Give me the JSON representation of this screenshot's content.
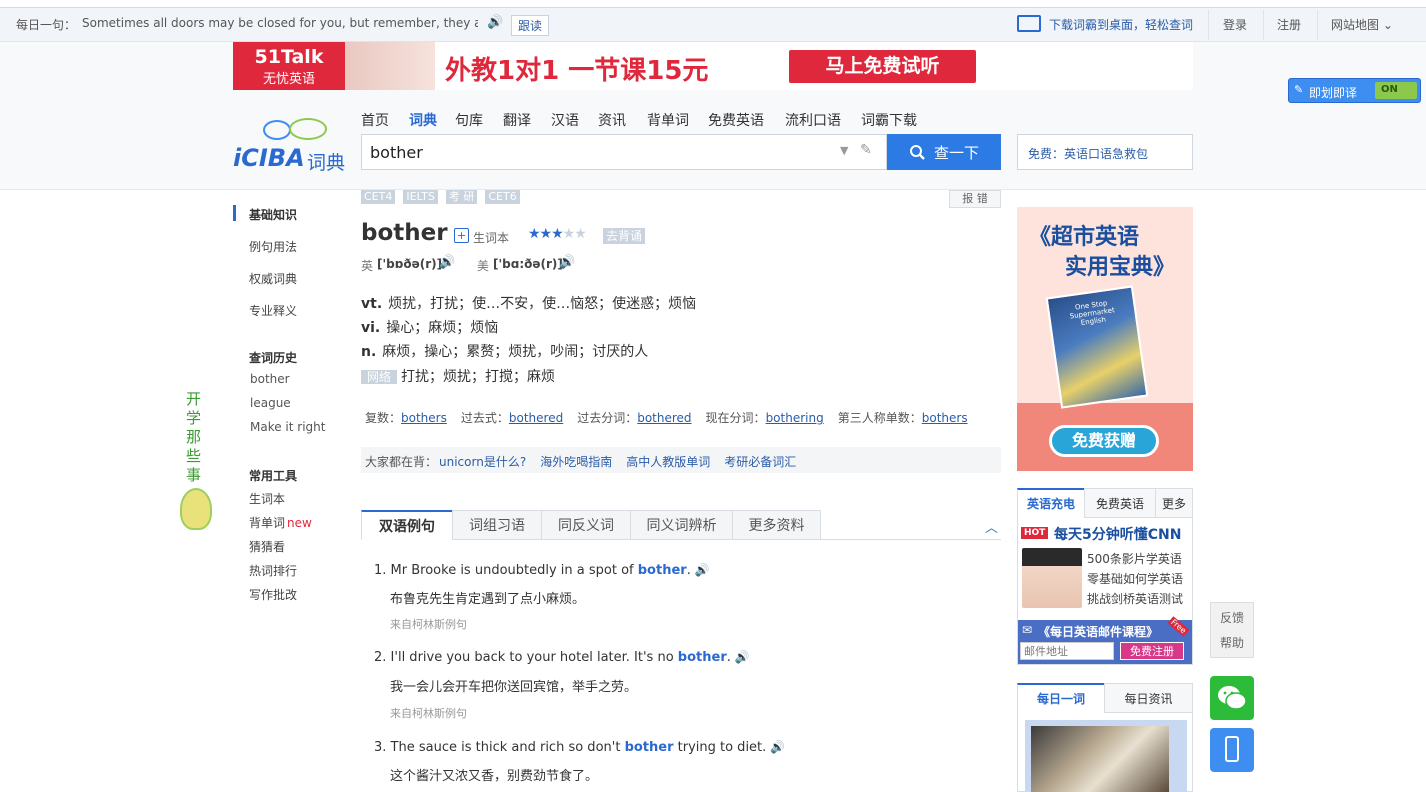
{
  "topbar": {
    "daily_label": "每日一句：",
    "daily_sentence": "Sometimes all doors may be closed for you, but remember, they aren't l...",
    "follow_read": "跟读",
    "download_link": "下载词霸到桌面，轻松查词",
    "login": "登录",
    "register": "注册",
    "sitemap": "网站地图"
  },
  "banner": {
    "brand": "51Talk",
    "brand_sub": "无忧英语",
    "headline": "外教1对1 一节课15元",
    "cta": "马上免费试听"
  },
  "toggle": {
    "label": "即划即译",
    "state": "ON"
  },
  "logo": {
    "text": "iCIBA",
    "suffix": "词典"
  },
  "nav": [
    "首页",
    "词典",
    "句库",
    "翻译",
    "汉语",
    "资讯",
    "背单词",
    "免费英语",
    "流利口语",
    "词霸下载"
  ],
  "search": {
    "value": "bother",
    "button": "查一下",
    "promo": "免费：英语口语急救包"
  },
  "tags": [
    "CET4",
    "IELTS",
    "考 研",
    "CET6"
  ],
  "report": "报 错",
  "sidebar": {
    "basic": "基础知识",
    "items": [
      "例句用法",
      "权威词典",
      "专业释义"
    ],
    "history_head": "查词历史",
    "history": [
      "bother",
      "league",
      "Make it right"
    ],
    "tools_head": "常用工具",
    "tools": [
      "生词本",
      "背单词",
      "猜猜看",
      "热词排行",
      "写作批改"
    ],
    "new_badge": "new"
  },
  "left_deco": "开学那些事",
  "word": {
    "headword": "bother",
    "add_vocab": "生词本",
    "stars": 3,
    "recite": "去背诵",
    "uk_label": "英",
    "uk_pron": "['bɒðə(r)]",
    "us_label": "美",
    "us_pron": "['bɑ:ðə(r)]"
  },
  "definitions": [
    {
      "pos": "vt.",
      "text": "烦扰，打扰；使…不安，使…恼怒；使迷惑；烦恼"
    },
    {
      "pos": "vi.",
      "text": "操心；麻烦；烦恼"
    },
    {
      "pos": "n.",
      "text": "麻烦，操心；累赘；烦扰，吵闹；讨厌的人"
    },
    {
      "pos": "网络",
      "text": "打扰；烦扰；打搅；麻烦"
    }
  ],
  "forms": [
    {
      "label": "复数：",
      "value": "bothers"
    },
    {
      "label": "过去式：",
      "value": "bothered"
    },
    {
      "label": "过去分词：",
      "value": "bothered"
    },
    {
      "label": "现在分词：",
      "value": "bothering"
    },
    {
      "label": "第三人称单数：",
      "value": "bothers"
    }
  ],
  "everyone": {
    "label": "大家都在背：",
    "links": [
      "unicorn是什么?",
      "海外吃喝指南",
      "高中人教版单词",
      "考研必备词汇"
    ]
  },
  "tabs": [
    "双语例句",
    "词组习语",
    "同反义词",
    "同义词辨析",
    "更多资料"
  ],
  "examples": [
    {
      "num": "1.",
      "pre": "Mr Brooke is undoubtedly in a spot of ",
      "kw": "bother",
      "post": ".",
      "zh": "布鲁克先生肯定遇到了点小麻烦。",
      "src": "来自柯林斯例句"
    },
    {
      "num": "2.",
      "pre": "I'll drive you back to your hotel later. It's no ",
      "kw": "bother",
      "post": ".",
      "zh": "我一会儿会开车把你送回宾馆，举手之劳。",
      "src": "来自柯林斯例句"
    },
    {
      "num": "3.",
      "pre": "The sauce is thick and rich so don't ",
      "kw": "bother",
      "post": " trying to diet.",
      "zh": "这个酱汁又浓又香，别费劲节食了。",
      "src": ""
    }
  ],
  "ad_book": {
    "title1": "《超市英语",
    "title1_hl": "英语",
    "title2": "实用宝典》",
    "book_en": "One Stop Supermarket English",
    "cta": "免费获赠"
  },
  "right_tabs": [
    "英语充电",
    "免费英语",
    "更多"
  ],
  "cnn": {
    "hot": "HOT",
    "title": "每天5分钟听懂CNN",
    "lines": [
      "500条影片学英语",
      "零基础如何学英语",
      "挑战剑桥英语测试"
    ]
  },
  "mail": {
    "title": "《每日英语邮件课程》",
    "free": "Free",
    "placeholder": "邮件地址",
    "button": "免费注册"
  },
  "daily_tabs": [
    "每日一词",
    "每日资讯"
  ],
  "float": {
    "feedback": "反馈",
    "help": "帮助"
  },
  "colors": {
    "accent": "#2c7be5",
    "link": "#2a5ca8",
    "banner_red": "#e0283c",
    "ad_pink": "#fde3dc"
  }
}
